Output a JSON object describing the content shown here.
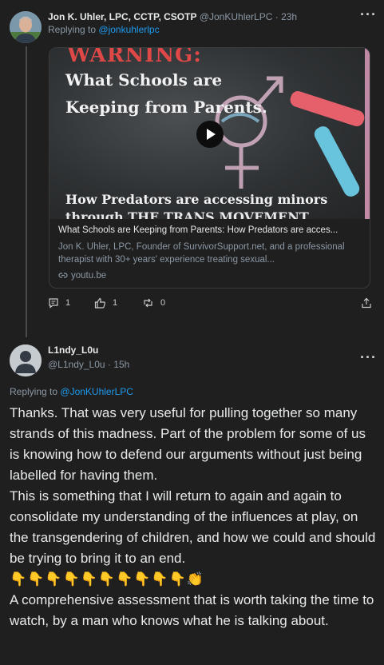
{
  "post1": {
    "author_name": "Jon K. Uhler, LPC, CCTP, CSOTP",
    "author_handle": "@JonKUhlerLPC",
    "time": "23h",
    "replying_prefix": "Replying to",
    "replying_handle": "@jonkuhlerlpc",
    "video": {
      "warning": "WARNING:",
      "line1": "What Schools are",
      "line2": "Keeping from Parents.",
      "line3": "How Predators are accessing minors",
      "line4": "through THE TRANS MOVEMENT"
    },
    "card": {
      "title": "What Schools are Keeping from Parents: How Predators are acces...",
      "description": "Jon K. Uhler, LPC, Founder of SurvivorSupport.net, and a professional therapist with 30+ years' experience treating sexual...",
      "link": "youtu.be"
    },
    "actions": {
      "replies": "1",
      "likes": "1",
      "retweets": "0"
    },
    "icons": [
      "reply-icon",
      "like-icon",
      "retweet-icon",
      "share-icon",
      "more-icon",
      "play-icon",
      "link-icon"
    ]
  },
  "post2": {
    "author_name": "L1ndy_L0u",
    "author_handle": "@L1ndy_L0u",
    "time": "15h",
    "replying_prefix": "Replying to",
    "replying_handle": "@JonKUhlerLPC",
    "paragraph1": "Thanks. That was very useful for pulling together so many strands of this madness. Part of the problem for some of us is knowing how to defend our arguments without just being labelled for having them.",
    "paragraph2": "This is something that I will return to again and again to consolidate my understanding of the influences at play, on the transgendering of children, and how we could and should be trying to bring it to an end.",
    "emojis": "👇👇👇👇👇👇👇👇👇👇👏",
    "paragraph3": "A comprehensive assessment that is worth taking the time to watch, by a man who knows what he is talking about."
  },
  "colors": {
    "background": "#1f1f1f",
    "text": "#e7e9ea",
    "muted": "#8b98a5",
    "link": "#1d9bf0",
    "warning_red": "#e04848"
  }
}
